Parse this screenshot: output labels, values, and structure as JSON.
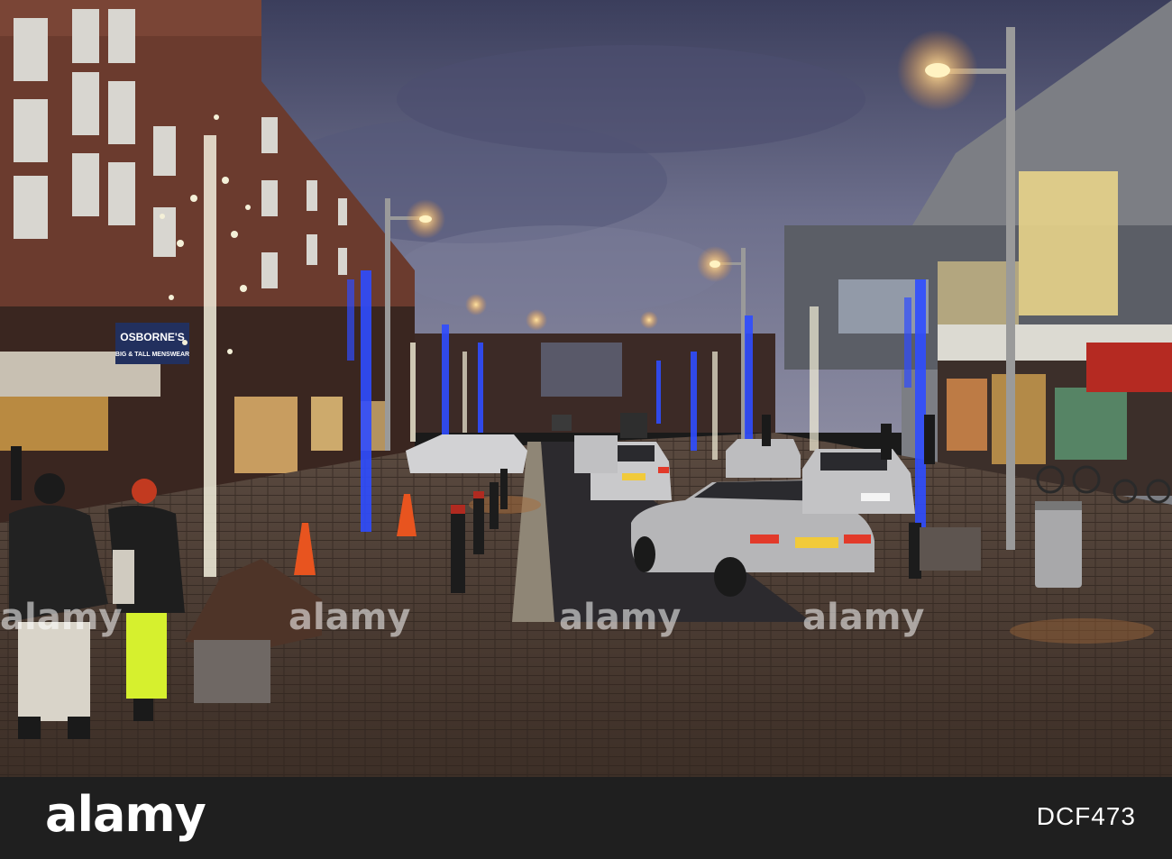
{
  "scene": {
    "description_visible_text": {
      "shop_sign_line1": "OSBORNE'S",
      "shop_sign_line2": "BIG & TALL MENSWEAR"
    },
    "watermarks": [
      "alamy",
      "alamy",
      "alamy",
      "alamy"
    ]
  },
  "footer": {
    "logo": "alamy",
    "image_id": "DCF473"
  },
  "colors": {
    "sky_top": "#3e4160",
    "sky_mid": "#6a6c88",
    "pavement": "#4a3a30",
    "street_light": "#ffb347",
    "blue_lights": "#2f4cff",
    "white_lights": "#f4f0d8",
    "footer_bg": "#1f1f1f"
  }
}
